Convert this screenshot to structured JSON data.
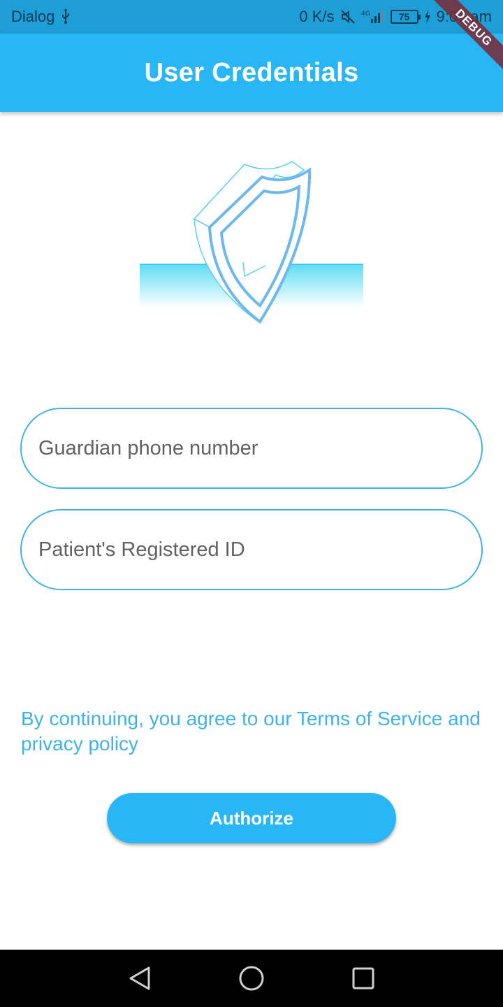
{
  "status_bar": {
    "carrier": "Dialog",
    "net_speed": "0 K/s",
    "network": "4G",
    "battery": "75",
    "time": "9:07 am"
  },
  "debug_banner": "DEBUG",
  "app_bar": {
    "title": "User Credentials"
  },
  "form": {
    "phone_placeholder": "Guardian phone number",
    "patient_id_placeholder": "Patient's Registered ID"
  },
  "terms_text": "By continuing, you agree to our Terms of Service and privacy policy",
  "authorize_label": "Authorize",
  "colors": {
    "primary": "#29b6f6",
    "status_bar": "#1d9ed6",
    "accent_text": "#3fb2e6"
  },
  "icons": {
    "usb": "usb-icon",
    "mute": "mute-icon",
    "signal": "signal-icon",
    "charging": "charging-icon",
    "back": "back-triangle-icon",
    "home": "home-circle-icon",
    "recents": "recents-square-icon",
    "illustration": "shield-icon"
  }
}
